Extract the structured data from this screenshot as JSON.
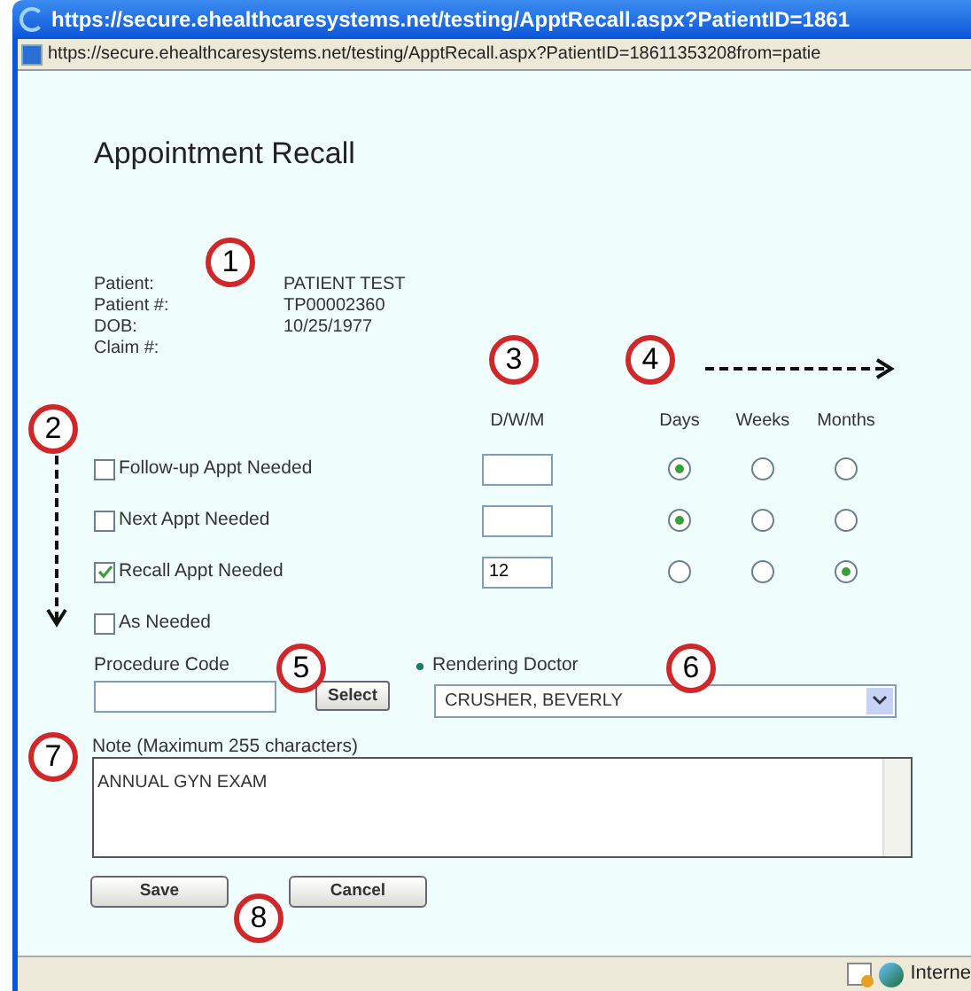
{
  "window": {
    "title": "https://secure.ehealthcaresystems.net/testing/ApptRecall.aspx?PatientID=1861"
  },
  "address": "https://secure.ehealthcaresystems.net/testing/ApptRecall.aspx?PatientID=18611353208from=patie",
  "heading": "Appointment Recall",
  "patient": [
    {
      "label": "Patient:",
      "value": "PATIENT TEST"
    },
    {
      "label": "Patient #:",
      "value": "TP00002360"
    },
    {
      "label": "DOB:",
      "value": "10/25/1977"
    },
    {
      "label": "Claim #:"
    }
  ],
  "columns": {
    "amount": "D/W/M",
    "units": [
      "Days",
      "Weeks",
      "Months"
    ]
  },
  "rows": [
    {
      "label": "Follow-up Appt Needed",
      "checked": false,
      "amount": "",
      "units": [
        true,
        false,
        false
      ]
    },
    {
      "label": "Next Appt Needed",
      "checked": false,
      "amount": "",
      "units": [
        true,
        false,
        false
      ]
    },
    {
      "label": "Recall Appt Needed",
      "checked": true,
      "amount": "12",
      "units": [
        false,
        false,
        true
      ]
    },
    {
      "label": "As Needed",
      "checked": false
    }
  ],
  "procedure_code": {
    "label": "Procedure Code",
    "button": "Select"
  },
  "rendering_doctor": {
    "label": "Rendering Doctor",
    "value": "CRUSHER, BEVERLY"
  },
  "note": {
    "label": "Note (Maximum 255 characters)",
    "value": "ANNUAL GYN EXAM"
  },
  "buttons": [
    "Save",
    "Cancel"
  ],
  "callouts": [
    "1",
    "2",
    "3",
    "4",
    "5",
    "6",
    "7",
    "8"
  ],
  "status_bar": {
    "zone": "Interne"
  }
}
